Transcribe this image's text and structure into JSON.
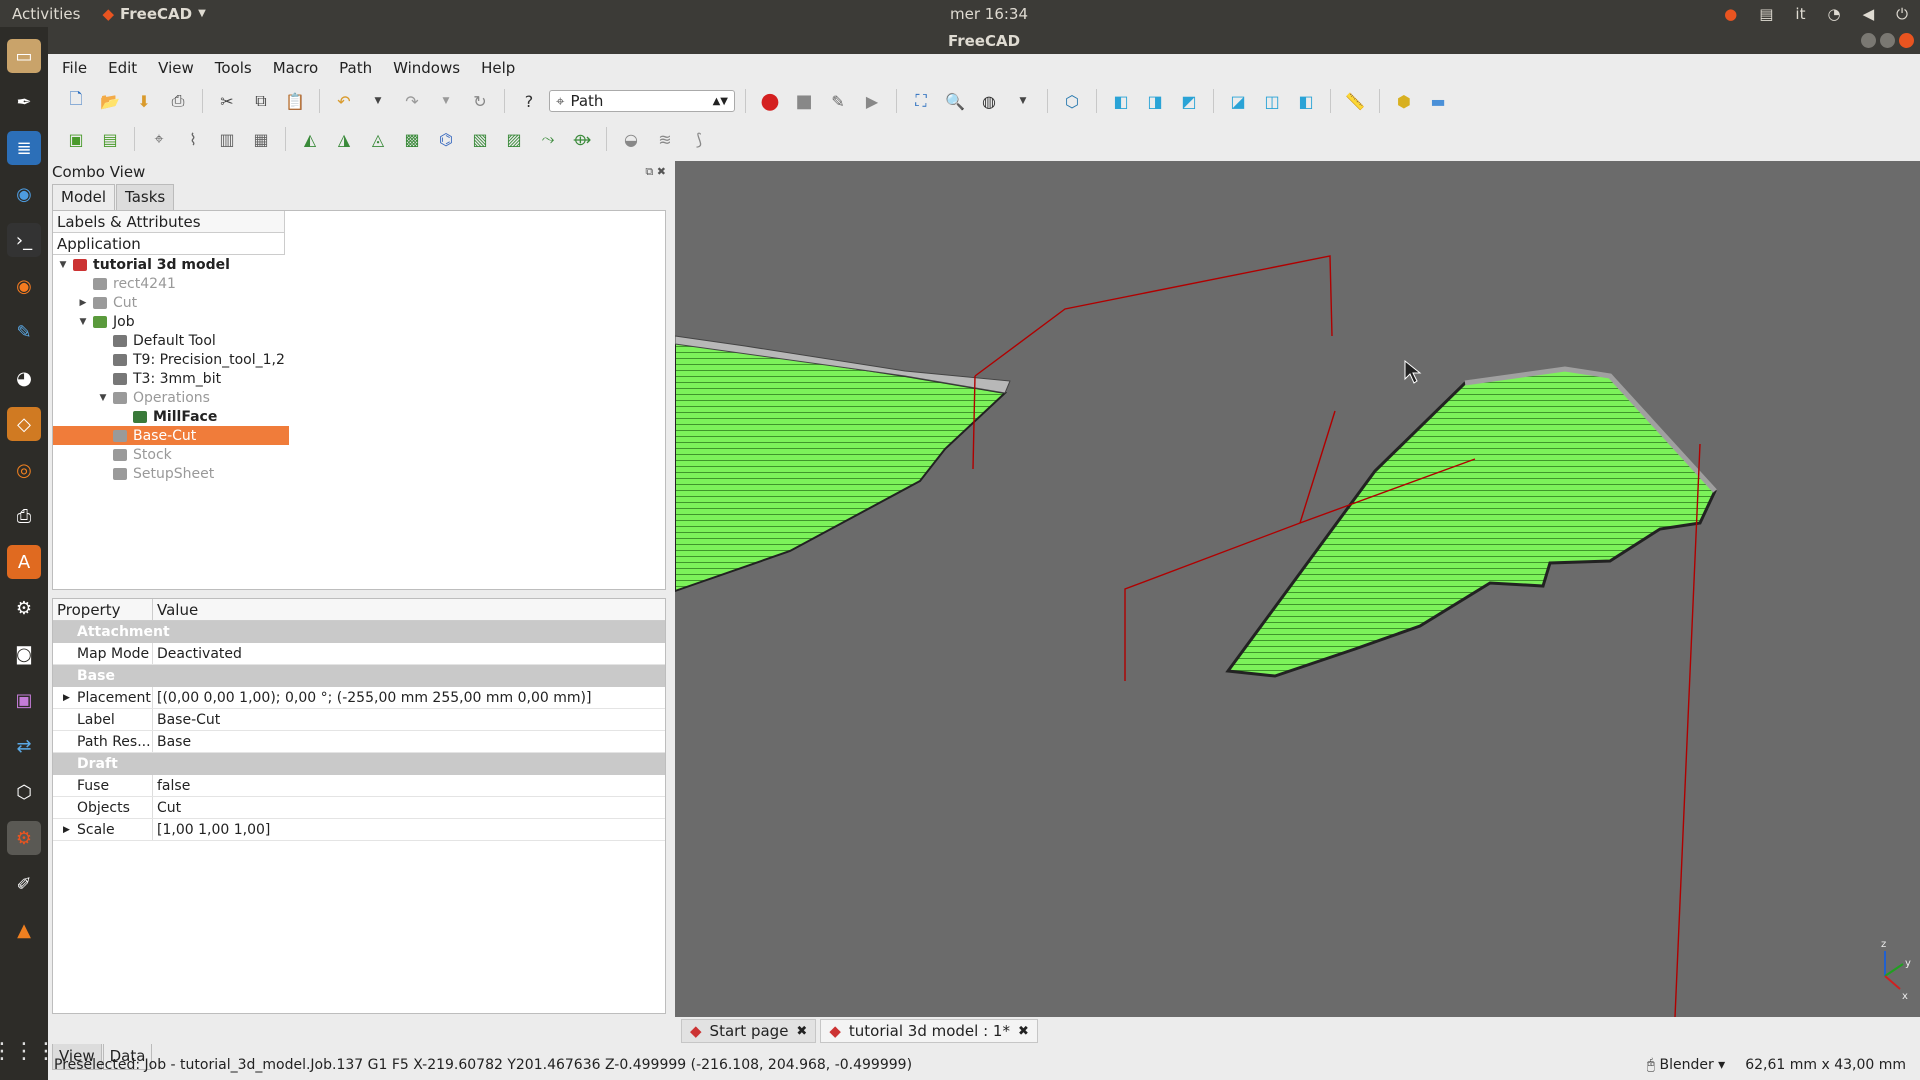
{
  "topbar": {
    "activities": "Activities",
    "app_name": "FreeCAD",
    "clock": "mer 16:34",
    "keyboard": "it"
  },
  "window": {
    "title": "FreeCAD"
  },
  "menu": [
    "File",
    "Edit",
    "View",
    "Tools",
    "Macro",
    "Path",
    "Windows",
    "Help"
  ],
  "workbench": {
    "selected": "Path"
  },
  "combo": {
    "title": "Combo View",
    "tabs": [
      "Model",
      "Tasks"
    ],
    "tree_header": "Labels & Attributes",
    "tree_root": "Application",
    "tree": [
      {
        "label": "tutorial 3d model",
        "indent": 0,
        "twisty": "▼",
        "style": "bold",
        "icon": "#c33"
      },
      {
        "label": "rect4241",
        "indent": 1,
        "twisty": "",
        "style": "dim",
        "icon": "#9a9a9a"
      },
      {
        "label": "Cut",
        "indent": 1,
        "twisty": "▶",
        "style": "dim",
        "icon": "#9a9a9a"
      },
      {
        "label": "Job",
        "indent": 1,
        "twisty": "▼",
        "style": "",
        "icon": "#5a9a3c"
      },
      {
        "label": "Default Tool",
        "indent": 2,
        "twisty": "",
        "style": "",
        "icon": "#777"
      },
      {
        "label": "T9: Precision_tool_1,2",
        "indent": 2,
        "twisty": "",
        "style": "",
        "icon": "#777"
      },
      {
        "label": "T3: 3mm_bit",
        "indent": 2,
        "twisty": "",
        "style": "",
        "icon": "#777"
      },
      {
        "label": "Operations",
        "indent": 2,
        "twisty": "▼",
        "style": "dim",
        "icon": "#9a9a9a"
      },
      {
        "label": "MillFace",
        "indent": 3,
        "twisty": "",
        "style": "bold",
        "icon": "#3a7a3a"
      },
      {
        "label": "Base-Cut",
        "indent": 2,
        "twisty": "",
        "style": "selected",
        "icon": "#9a9a9a"
      },
      {
        "label": "Stock",
        "indent": 2,
        "twisty": "",
        "style": "dim",
        "icon": "#9a9a9a"
      },
      {
        "label": "SetupSheet",
        "indent": 2,
        "twisty": "",
        "style": "dim",
        "icon": "#9a9a9a"
      }
    ]
  },
  "properties": {
    "header_property": "Property",
    "header_value": "Value",
    "rows": [
      {
        "group": "Attachment"
      },
      {
        "name": "Map Mode",
        "value": "Deactivated"
      },
      {
        "group": "Base"
      },
      {
        "name": "Placement",
        "value": "[(0,00 0,00 1,00); 0,00 °; (-255,00 mm  255,00 mm  0,00 mm)]",
        "expand": true
      },
      {
        "name": "Label",
        "value": "Base-Cut"
      },
      {
        "name": "Path Res...",
        "value": "Base"
      },
      {
        "group": "Draft"
      },
      {
        "name": "Fuse",
        "value": "false"
      },
      {
        "name": "Objects",
        "value": "Cut"
      },
      {
        "name": "Scale",
        "value": "[1,00 1,00 1,00]",
        "expand": true
      }
    ]
  },
  "bottom_tabs": [
    "View",
    "Data"
  ],
  "doc_tabs": [
    {
      "label": "Start page",
      "active": false
    },
    {
      "label": "tutorial 3d model : 1*",
      "active": true
    }
  ],
  "status": {
    "message": "Preselected: Job - tutorial_3d_model.Job.137 G1 F5 X-219.60782 Y201.467636 Z-0.499999 (-216.108, 204.968, -0.499999)",
    "nav_style": "Blender",
    "dimensions": "62,61 mm x 43,00 mm"
  },
  "axis_labels": {
    "z": "z",
    "y": "y",
    "x": "x"
  },
  "colors": {
    "accent": "#f07c3a",
    "face": "#7cf25a",
    "path": "#b00000"
  }
}
